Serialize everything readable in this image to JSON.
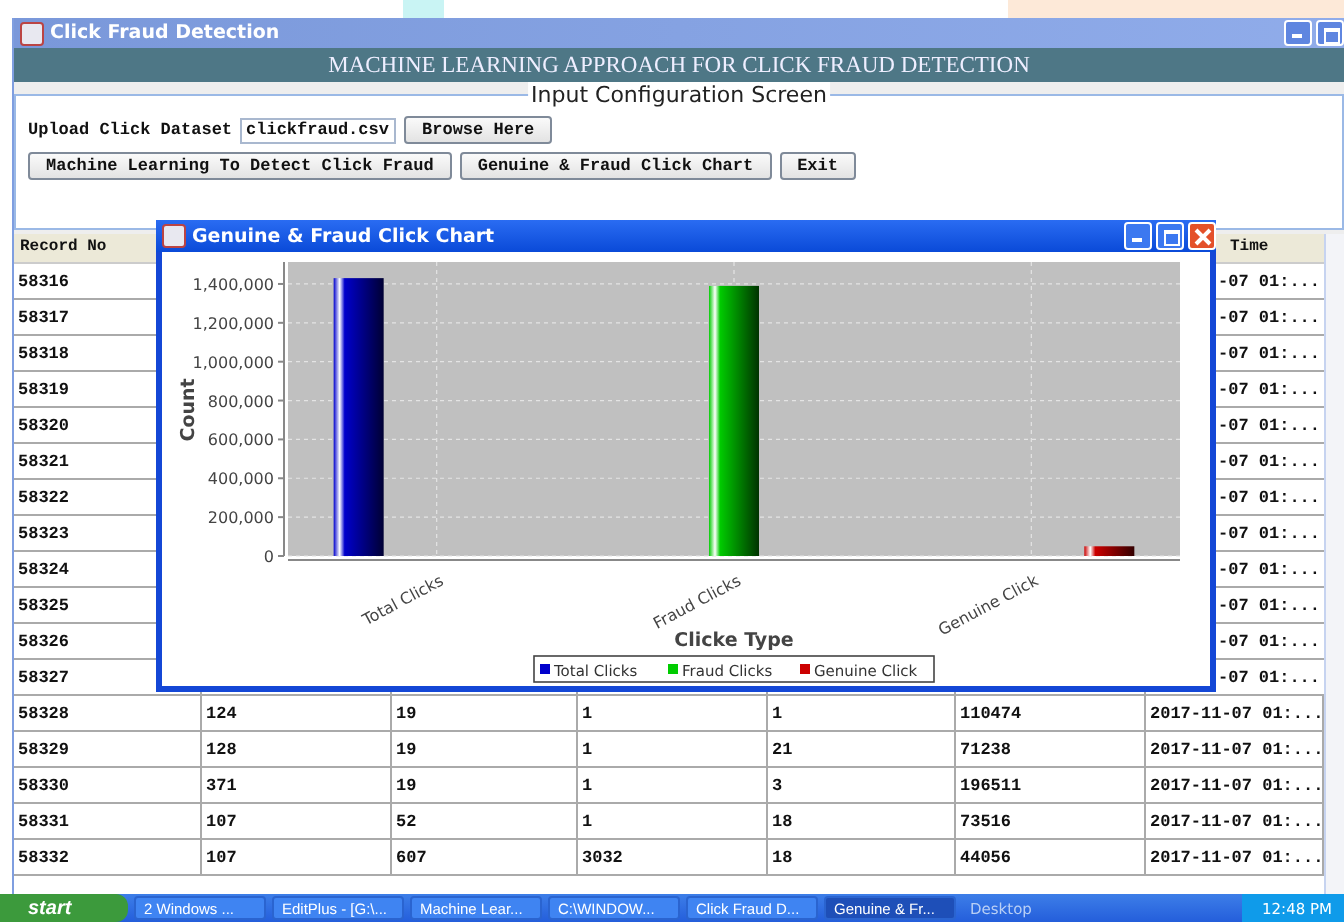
{
  "window": {
    "title": "Click Fraud Detection",
    "heading": "MACHINE LEARNING APPROACH FOR CLICK FRAUD DETECTION"
  },
  "config_panel": {
    "title": "Input Configuration Screen",
    "upload_label": "Upload Click Dataset",
    "upload_value": "clickfraud.csv",
    "browse_button": "Browse Here",
    "buttons": [
      "Machine Learning To Detect Click Fraud",
      "Genuine & Fraud Click Chart",
      "Exit"
    ]
  },
  "table": {
    "column_1": "Record No",
    "column_7": "Time",
    "rows": [
      {
        "kind": "covered",
        "record_no": "58316",
        "time_fragment": "-07 01:..."
      },
      {
        "kind": "covered",
        "record_no": "58317",
        "time_fragment": "-07 01:..."
      },
      {
        "kind": "covered",
        "record_no": "58318",
        "time_fragment": "-07 01:..."
      },
      {
        "kind": "covered",
        "record_no": "58319",
        "time_fragment": "-07 01:..."
      },
      {
        "kind": "covered",
        "record_no": "58320",
        "time_fragment": "-07 01:..."
      },
      {
        "kind": "covered",
        "record_no": "58321",
        "time_fragment": "-07 01:..."
      },
      {
        "kind": "covered",
        "record_no": "58322",
        "time_fragment": "-07 01:..."
      },
      {
        "kind": "covered",
        "record_no": "58323",
        "time_fragment": "-07 01:..."
      },
      {
        "kind": "covered",
        "record_no": "58324",
        "time_fragment": "-07 01:..."
      },
      {
        "kind": "covered",
        "record_no": "58325",
        "time_fragment": "-07 01:..."
      },
      {
        "kind": "covered",
        "record_no": "58326",
        "time_fragment": "-07 01:..."
      },
      {
        "kind": "covered",
        "record_no": "58327",
        "time_fragment": "-07 01:..."
      },
      {
        "kind": "full",
        "cells": [
          "58328",
          "124",
          "19",
          "1",
          "1",
          "110474",
          "2017-11-07 01:..."
        ]
      },
      {
        "kind": "full",
        "cells": [
          "58329",
          "128",
          "19",
          "1",
          "21",
          "71238",
          "2017-11-07 01:..."
        ]
      },
      {
        "kind": "full",
        "cells": [
          "58330",
          "371",
          "19",
          "1",
          "3",
          "196511",
          "2017-11-07 01:..."
        ]
      },
      {
        "kind": "full",
        "cells": [
          "58331",
          "107",
          "52",
          "1",
          "18",
          "73516",
          "2017-11-07 01:..."
        ]
      },
      {
        "kind": "full",
        "cells": [
          "58332",
          "107",
          "607",
          "3032",
          "18",
          "44056",
          "2017-11-07 01:..."
        ]
      }
    ]
  },
  "dialog": {
    "title": "Genuine & Fraud Click Chart",
    "chart_data": {
      "type": "bar",
      "xlabel": "Clicke Type",
      "ylabel": "Count",
      "categories": [
        "Total Clicks",
        "Fraud Clicks",
        "Genuine Click"
      ],
      "series": [
        {
          "name": "Total Clicks",
          "color": "#0000cc",
          "values": [
            1430000,
            null,
            null
          ]
        },
        {
          "name": "Fraud Clicks",
          "color": "#00cc00",
          "values": [
            null,
            1390000,
            null
          ]
        },
        {
          "name": "Genuine Click",
          "color": "#cc0000",
          "values": [
            null,
            null,
            50000
          ]
        }
      ],
      "grid": true,
      "legend": true,
      "ylim": [
        0,
        1513000
      ],
      "yticks": [
        {
          "value": 0,
          "label": "0"
        },
        {
          "value": 200000,
          "label": "200,000"
        },
        {
          "value": 400000,
          "label": "400,000"
        },
        {
          "value": 600000,
          "label": "600,000"
        },
        {
          "value": 800000,
          "label": "800,000"
        },
        {
          "value": 1000000,
          "label": "1,000,000"
        },
        {
          "value": 1200000,
          "label": "1,200,000"
        },
        {
          "value": 1400000,
          "label": "1,400,000"
        }
      ]
    }
  },
  "taskbar": {
    "start": "start",
    "items": [
      {
        "label": "2 Windows ...",
        "selected": false
      },
      {
        "label": "EditPlus - [G:\\...",
        "selected": false
      },
      {
        "label": "Machine Lear...",
        "selected": false
      },
      {
        "label": "C:\\WINDOW...",
        "selected": false
      },
      {
        "label": "Click Fraud D...",
        "selected": false
      },
      {
        "label": "Genuine & Fr...",
        "selected": true
      }
    ],
    "desktop": "Desktop",
    "clock": "12:48 PM"
  }
}
